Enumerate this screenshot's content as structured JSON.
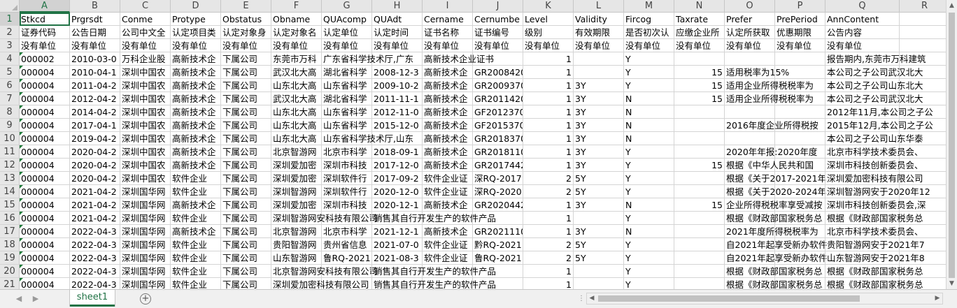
{
  "workbook": {
    "active_cell": "A1",
    "columns": [
      "A",
      "B",
      "C",
      "D",
      "E",
      "F",
      "G",
      "H",
      "I",
      "J",
      "K",
      "L",
      "M",
      "N",
      "O",
      "P",
      "Q",
      "R"
    ],
    "rows": [
      {
        "n": "1",
        "cells": [
          "Stkcd",
          "Prgrsdt",
          "Conme",
          "Protype",
          "Obstatus",
          "Obname",
          "QUAcomp",
          "QUAdt",
          "Cername",
          "Cernumbe",
          "Level",
          "Validity",
          "Fircog",
          "Taxrate",
          "Prefer",
          "PrePeriod",
          "AnnContent",
          ""
        ]
      },
      {
        "n": "2",
        "cells": [
          "证券代码",
          "公告日期",
          "公司中文全",
          "认定项目类",
          "认定对象身",
          "认定对象名",
          "认定单位",
          "认定时间",
          "证书名称",
          "证书编号",
          "级别",
          "有效期限",
          "是否初次认",
          "应缴企业所",
          "认定所获取",
          "优惠期限",
          "公告内容",
          ""
        ]
      },
      {
        "n": "3",
        "cells": [
          "没有单位",
          "没有单位",
          "没有单位",
          "没有单位",
          "没有单位",
          "没有单位",
          "没有单位",
          "没有单位",
          "没有单位",
          "没有单位",
          "没有单位",
          "没有单位",
          "没有单位",
          "没有单位",
          "没有单位",
          "没有单位",
          "没有单位",
          ""
        ]
      },
      {
        "n": "4",
        "cells": [
          "000002",
          "2010-03-0",
          "万科企业股",
          "高新技术企",
          "下属公司",
          "东莞市万科",
          "广东省科学技术厅,广东",
          "",
          "高新技术企业证书",
          "",
          "1",
          "",
          "Y",
          "",
          "",
          "",
          "报告期内,东莞市万科建筑",
          ""
        ]
      },
      {
        "n": "5",
        "cells": [
          "000004",
          "2010-04-1",
          "深圳中国农",
          "高新技术企",
          "下属公司",
          "武汉北大高",
          "湖北省科学",
          "2008-12-3",
          "高新技术企",
          "GR2008420",
          "1",
          "",
          "Y",
          "15",
          "适用税率为15%",
          "",
          "本公司之子公司武汉北大",
          ""
        ]
      },
      {
        "n": "6",
        "cells": [
          "000004",
          "2011-04-2",
          "深圳中国农",
          "高新技术企",
          "下属公司",
          "山东北大高",
          "山东省科学",
          "2009-10-2",
          "高新技术企",
          "GR2009370",
          "1",
          "3Y",
          "Y",
          "15",
          "适用企业所得税税率为",
          "",
          "本公司之子公司山东北大",
          ""
        ]
      },
      {
        "n": "7",
        "cells": [
          "000004",
          "2012-04-2",
          "深圳中国农",
          "高新技术企",
          "下属公司",
          "武汉北大高",
          "湖北省科学",
          "2011-11-1",
          "高新技术企",
          "GR2011420",
          "1",
          "3Y",
          "N",
          "15",
          "适用企业所得税税率为",
          "",
          "本公司之子公司武汉北大",
          ""
        ]
      },
      {
        "n": "8",
        "cells": [
          "000004",
          "2014-04-2",
          "深圳中国农",
          "高新技术企",
          "下属公司",
          "山东北大高",
          "山东省科学",
          "2012-11-0",
          "高新技术企",
          "GF2012370",
          "1",
          "3Y",
          "N",
          "",
          "",
          "",
          "2012年11月,本公司之子公",
          ""
        ]
      },
      {
        "n": "9",
        "cells": [
          "000004",
          "2017-04-1",
          "深圳中国农",
          "高新技术企",
          "下属公司",
          "山东北大高",
          "山东省科学",
          "2015-12-0",
          "高新技术企",
          "GF2015370",
          "1",
          "3Y",
          "N",
          "",
          "2016年度企业所得税按",
          "",
          "2015年12月,本公司之子公",
          ""
        ]
      },
      {
        "n": "10",
        "cells": [
          "000004",
          "2019-04-2",
          "深圳中国农",
          "高新技术企",
          "下属公司",
          "山东北大高",
          "山东省科学技术厅,山东",
          "",
          "高新技术企",
          "GR2018370",
          "1",
          "3Y",
          "N",
          "",
          "",
          "",
          "本公司之子公司山东华泰",
          ""
        ]
      },
      {
        "n": "11",
        "cells": [
          "000004",
          "2020-04-2",
          "深圳中国农",
          "高新技术企",
          "下属公司",
          "北京智游网",
          "北京市科学",
          "2018-09-1",
          "高新技术企",
          "GR2018110",
          "1",
          "3Y",
          "Y",
          "",
          "2020年年报:2020年度",
          "",
          "北京市科学技术委员会、",
          ""
        ]
      },
      {
        "n": "12",
        "cells": [
          "000004",
          "2020-04-2",
          "深圳中国农",
          "高新技术企",
          "下属公司",
          "深圳爱加密",
          "深圳市科技",
          "2017-12-0",
          "高新技术企",
          "GR2017442",
          "1",
          "3Y",
          "Y",
          "15",
          "根据《中华人民共和国",
          "",
          "深圳市科技创新委员会、",
          ""
        ]
      },
      {
        "n": "13",
        "cells": [
          "000004",
          "2020-04-2",
          "深圳中国农",
          "软件企业",
          "下属公司",
          "深圳爱加密",
          "深圳软件行",
          "2017-09-2",
          "软件企业证",
          "深RQ-2017",
          "2",
          "5Y",
          "Y",
          "",
          "根据《关于2017-2021年",
          "",
          "深圳爱加密科技有限公司",
          ""
        ]
      },
      {
        "n": "14",
        "cells": [
          "000004",
          "2021-04-2",
          "深圳国华网",
          "软件企业",
          "下属公司",
          "深圳智游网",
          "深圳软件行",
          "2020-12-0",
          "软件企业证",
          "深RQ-2020",
          "2",
          "5Y",
          "Y",
          "",
          "根据《关于2020-2024年",
          "",
          "深圳智游网安于2020年12",
          ""
        ]
      },
      {
        "n": "15",
        "cells": [
          "000004",
          "2021-04-2",
          "深圳国华网",
          "高新技术企",
          "下属公司",
          "深圳爱加密",
          "深圳市科技",
          "2020-12-1",
          "高新技术企",
          "GR2020442",
          "1",
          "3Y",
          "N",
          "15",
          "企业所得税税率享受减按",
          "",
          "深圳市科技创新委员会,深",
          ""
        ]
      },
      {
        "n": "16",
        "cells": [
          "000004",
          "2021-04-2",
          "深圳国华网",
          "软件企业",
          "下属公司",
          "深圳智游网安科技有限公司",
          "",
          "销售其自行开发生产的软件产品",
          "",
          "",
          "1",
          "",
          "Y",
          "",
          "根据《财政部国家税务总",
          "",
          "根据《财政部国家税务总",
          ""
        ]
      },
      {
        "n": "17",
        "cells": [
          "000004",
          "2022-04-3",
          "深圳国华网",
          "高新技术企",
          "下属公司",
          "北京智游网",
          "北京市科学",
          "2021-12-1",
          "高新技术企",
          "GR2021110",
          "1",
          "3Y",
          "N",
          "",
          "2021年度所得税税率为",
          "",
          "北京市科学技术委员会、",
          ""
        ]
      },
      {
        "n": "18",
        "cells": [
          "000004",
          "2022-04-3",
          "深圳国华网",
          "软件企业",
          "下属公司",
          "贵阳智游网",
          "贵州省信息",
          "2021-07-0",
          "软件企业证",
          "黔RQ-2021",
          "2",
          "5Y",
          "Y",
          "",
          "自2021年起享受新办软件",
          "",
          "贵阳智游网安于2021年7",
          ""
        ]
      },
      {
        "n": "19",
        "cells": [
          "000004",
          "2022-04-3",
          "深圳国华网",
          "软件企业",
          "下属公司",
          "山东智游网",
          "鲁RQ-2021",
          "2021-08-3",
          "软件企业证",
          "鲁RQ-2021",
          "2",
          "5Y",
          "Y",
          "",
          "自2021年起享受新办软件",
          "",
          "山东智游网安于2021年8",
          ""
        ]
      },
      {
        "n": "20",
        "cells": [
          "000004",
          "2022-04-3",
          "深圳国华网",
          "软件企业",
          "下属公司",
          "北京智游网安科技有限公司",
          "",
          "销售其自行开发生产的软件产品",
          "",
          "",
          "1",
          "",
          "Y",
          "",
          "根据《财政部国家税务总",
          "",
          "根据《财政部国家税务总",
          ""
        ]
      },
      {
        "n": "21",
        "cells": [
          "000004",
          "2022-04-3",
          "深圳国华网",
          "软件企业",
          "下属公司",
          "深圳爱加密科技有限公司",
          "",
          "销售其自行开发生产的软件产品",
          "",
          "",
          "1",
          "",
          "Y",
          "",
          "根据《财政部国家税务总",
          "",
          "根据《财政部国家税务总",
          ""
        ]
      }
    ]
  },
  "sheet_tabs": [
    "sheet1"
  ],
  "add_sheet_label": "⊕",
  "icons": {
    "nav_prev": "◀",
    "nav_next": "▶",
    "scroll_up": "▲",
    "scroll_down": "▼",
    "scroll_left": "◀",
    "scroll_right": "▶"
  },
  "colors": {
    "accent": "#217346",
    "gridline": "#d4d4d4",
    "header_bg": "#e6e6e6"
  }
}
